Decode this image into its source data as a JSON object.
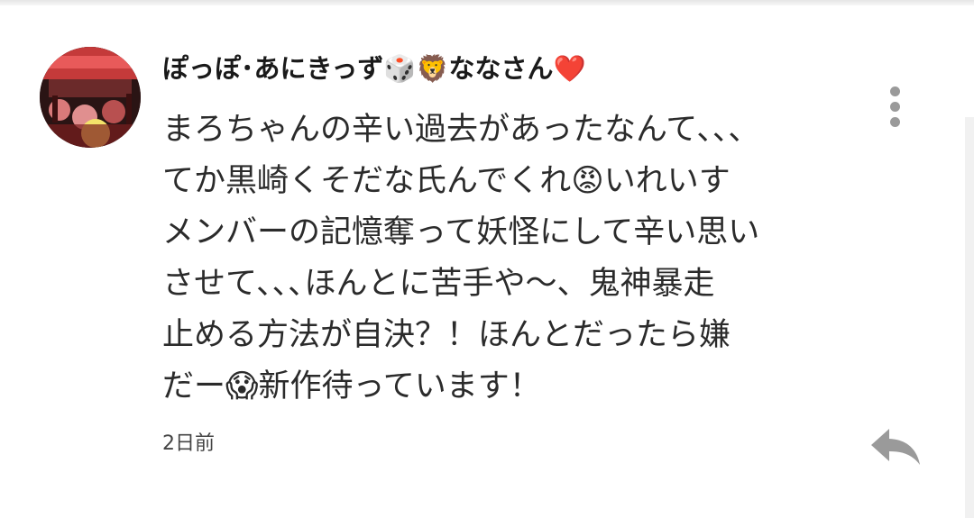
{
  "comment": {
    "author": "ぽっぽ･あにきっず🎲🦁ななさん❤️",
    "lines": [
      "まろちゃんの辛い過去があったなんて､､､",
      "てか黒崎くそだな氏んでくれ😡いれいす",
      "メンバーの記憶奪って妖怪にして辛い思い",
      "させて､､､ほんとに苦手や〜、鬼神暴走",
      "止める方法が自決？！ほんとだったら嫌",
      "だー😱新作待っています！"
    ],
    "timestamp": "2日前"
  },
  "icons": {
    "avatar": "profile-photo",
    "more": "vertical-ellipsis-icon",
    "reply": "reply-arrow-icon"
  },
  "colors": {
    "author_text": "#1a1a1a",
    "body_text": "#2b2b2b",
    "meta_text": "#444444",
    "icon_gray": "#9a9a9a"
  }
}
